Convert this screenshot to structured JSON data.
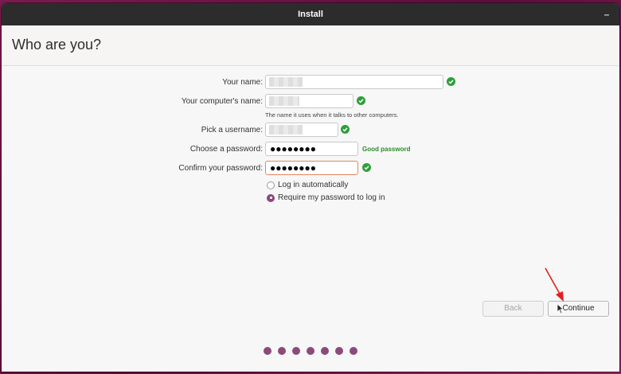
{
  "window": {
    "title": "Install",
    "minimize_glyph": "–"
  },
  "header": {
    "title": "Who are you?"
  },
  "form": {
    "name_label": "Your name:",
    "computer_label": "Your computer's name:",
    "computer_hint": "The name it uses when it talks to other computers.",
    "username_label": "Pick a username:",
    "password_label": "Choose a password:",
    "password_value": "●●●●●●●●",
    "password_strength": "Good password",
    "confirm_label": "Confirm your password:",
    "confirm_value": "●●●●●●●●"
  },
  "login_options": {
    "auto_label": "Log in automatically",
    "require_label": "Require my password to log in",
    "selected": "require"
  },
  "buttons": {
    "back_label": "Back",
    "continue_label": "Continue"
  },
  "progress": {
    "total_steps": 7,
    "dot_color": "#8b4a7c"
  },
  "colors": {
    "check": "#2c9f3a",
    "strength": "#2c8a2c",
    "focus_border": "#e9855f",
    "arrow": "#e02020"
  }
}
